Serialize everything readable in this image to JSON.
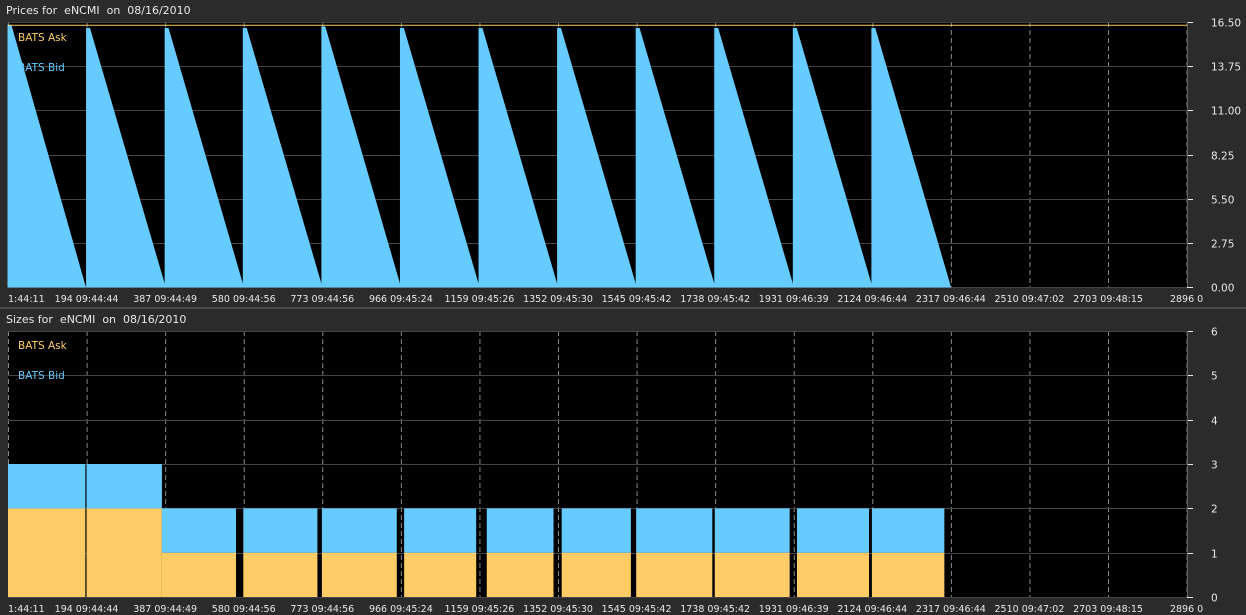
{
  "colors": {
    "ask": "#ffcc66",
    "bid": "#66ccff",
    "plot_bg": "#000000",
    "panel_bg": "#2b2b2b",
    "grid": "#888888",
    "text": "#e8e8e8"
  },
  "x_tick_labels": [
    "1:44:11",
    "194 09:44:44",
    "387 09:44:49",
    "580 09:44:56",
    "773 09:44:56",
    "966 09:45:24",
    "1159 09:45:26",
    "1352 09:45:30",
    "1545 09:45:42",
    "1738 09:45:42",
    "1931 09:46:39",
    "2124 09:46:44",
    "2317 09:46:44",
    "2510 09:47:02",
    "2703 09:48:15",
    "2896 0"
  ],
  "chart_data": [
    {
      "type": "area",
      "title": "Prices for  eNCMI  on  08/16/2010",
      "legend_position": "top-left",
      "grid": true,
      "xlim": [
        0,
        2896
      ],
      "ylim": [
        0,
        16.5
      ],
      "y_ticks": [
        "0.00",
        "2.75",
        "5.50",
        "8.25",
        "11.00",
        "13.75",
        "16.50"
      ],
      "series": [
        {
          "name": "BATS Ask",
          "color": "#ffcc66",
          "description": "flat near top",
          "level": 16.3
        },
        {
          "name": "BATS Bid",
          "color": "#66ccff",
          "cycles": [
            {
              "start": 0,
              "end": 190,
              "high": 16.3
            },
            {
              "start": 193,
              "end": 386,
              "high": 16.1
            },
            {
              "start": 386,
              "end": 578,
              "high": 16.1
            },
            {
              "start": 578,
              "end": 771,
              "high": 16.1
            },
            {
              "start": 771,
              "end": 964,
              "high": 16.2
            },
            {
              "start": 964,
              "end": 1157,
              "high": 16.1
            },
            {
              "start": 1157,
              "end": 1350,
              "high": 16.1
            },
            {
              "start": 1350,
              "end": 1543,
              "high": 16.1
            },
            {
              "start": 1543,
              "end": 1736,
              "high": 16.1
            },
            {
              "start": 1736,
              "end": 1929,
              "high": 16.1
            },
            {
              "start": 1929,
              "end": 2122,
              "high": 16.1
            },
            {
              "start": 2122,
              "end": 2315,
              "high": 16.1
            }
          ]
        }
      ]
    },
    {
      "type": "area",
      "title": "Sizes for  eNCMI  on  08/16/2010",
      "legend_position": "top-left",
      "grid": true,
      "xlim": [
        0,
        2896
      ],
      "ylim": [
        0,
        6
      ],
      "y_ticks": [
        "0",
        "1",
        "2",
        "3",
        "4",
        "5",
        "6"
      ],
      "series": [
        {
          "name": "BATS Ask",
          "color": "#ffcc66"
        },
        {
          "name": "BATS Bid",
          "color": "#66ccff"
        }
      ],
      "segments": [
        {
          "x0": 0,
          "x1": 190,
          "bid": 1,
          "ask": 2
        },
        {
          "x0": 193,
          "x1": 378,
          "bid": 1,
          "ask": 2
        },
        {
          "x0": 378,
          "x1": 560,
          "bid": 1,
          "ask": 1
        },
        {
          "x0": 578,
          "x1": 760,
          "bid": 1,
          "ask": 1
        },
        {
          "x0": 771,
          "x1": 955,
          "bid": 1,
          "ask": 1
        },
        {
          "x0": 973,
          "x1": 1150,
          "bid": 1,
          "ask": 1
        },
        {
          "x0": 1176,
          "x1": 1340,
          "bid": 1,
          "ask": 1
        },
        {
          "x0": 1360,
          "x1": 1530,
          "bid": 1,
          "ask": 1
        },
        {
          "x0": 1543,
          "x1": 1730,
          "bid": 1,
          "ask": 1
        },
        {
          "x0": 1736,
          "x1": 1920,
          "bid": 1,
          "ask": 1
        },
        {
          "x0": 1938,
          "x1": 2115,
          "bid": 1,
          "ask": 1
        },
        {
          "x0": 2122,
          "x1": 2300,
          "bid": 1,
          "ask": 1
        }
      ]
    }
  ]
}
